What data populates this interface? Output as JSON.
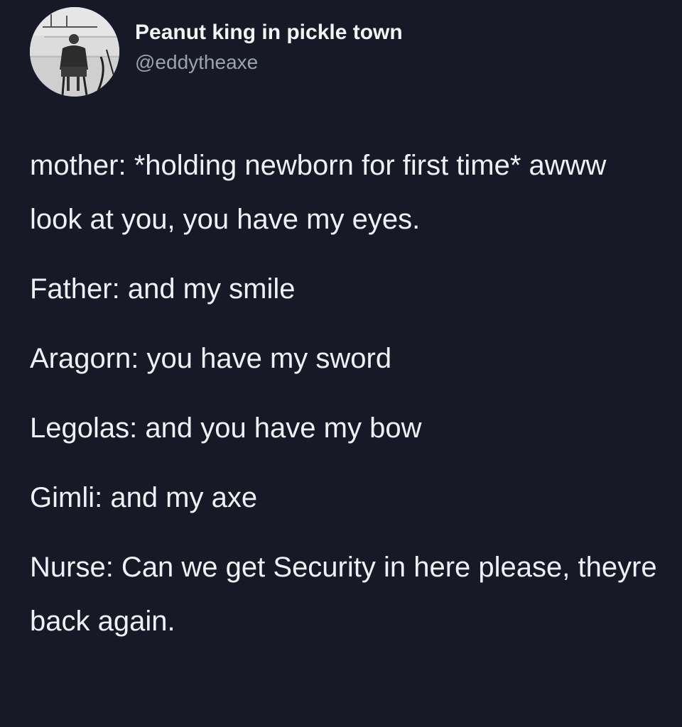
{
  "author": {
    "display_name": "Peanut king in pickle town",
    "handle": "@eddytheaxe",
    "avatar_icon": "profile-photo"
  },
  "tweet": {
    "lines": [
      "mother: *holding newborn for first time* awww look at you, you have my eyes.",
      "Father: and my smile",
      "Aragorn: you have my sword",
      "Legolas: and you have my bow",
      "Gimli: and my axe",
      "Nurse: Can we get Security in here please, theyre back again."
    ]
  },
  "colors": {
    "background": "#171a26",
    "text": "#eef0f3",
    "handle": "#9aa3ad"
  }
}
